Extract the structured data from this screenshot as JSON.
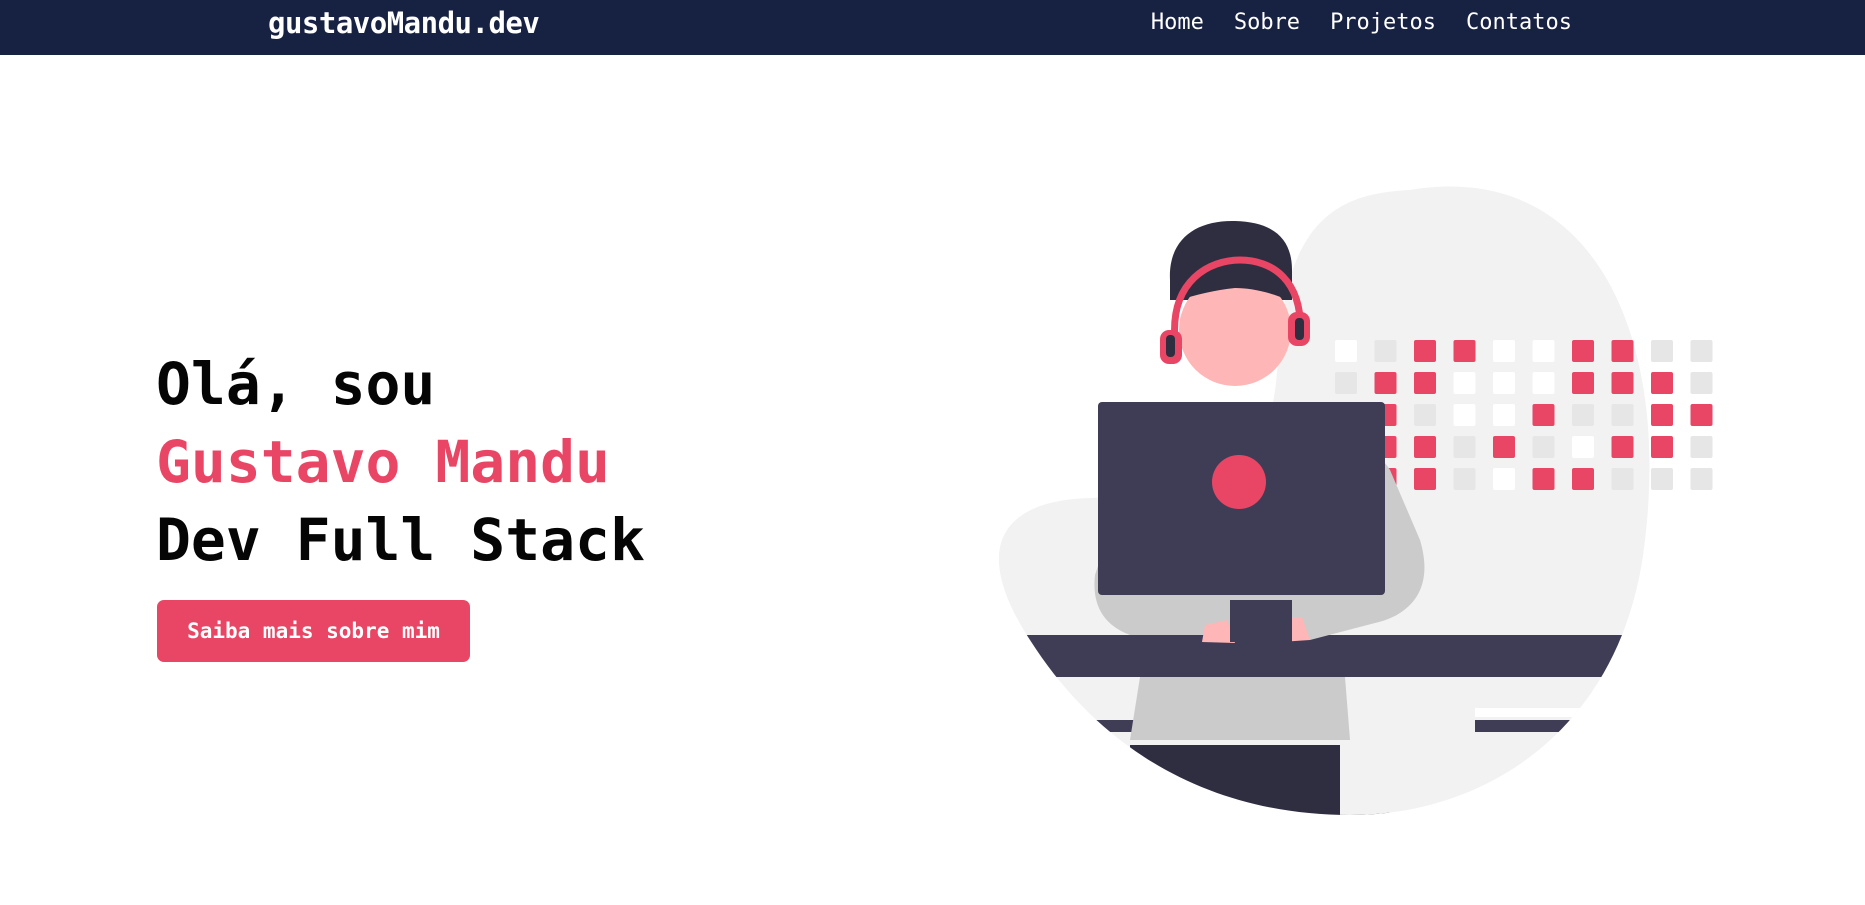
{
  "header": {
    "brand": "gustavoMandu.dev",
    "nav": [
      "Home",
      "Sobre",
      "Projetos",
      "Contatos"
    ]
  },
  "hero": {
    "greeting": "Olá, sou",
    "name": "Gustavo Mandu",
    "role": "Dev Full Stack",
    "cta_label": "Saiba mais sobre mim"
  },
  "colors": {
    "navbar": "#172142",
    "accent": "#e84664",
    "text": "#050505",
    "illustration_dark": "#3f3d56",
    "skin": "#ffb6b6"
  },
  "illustration": {
    "icon": "developer-with-headphones-illustration"
  }
}
